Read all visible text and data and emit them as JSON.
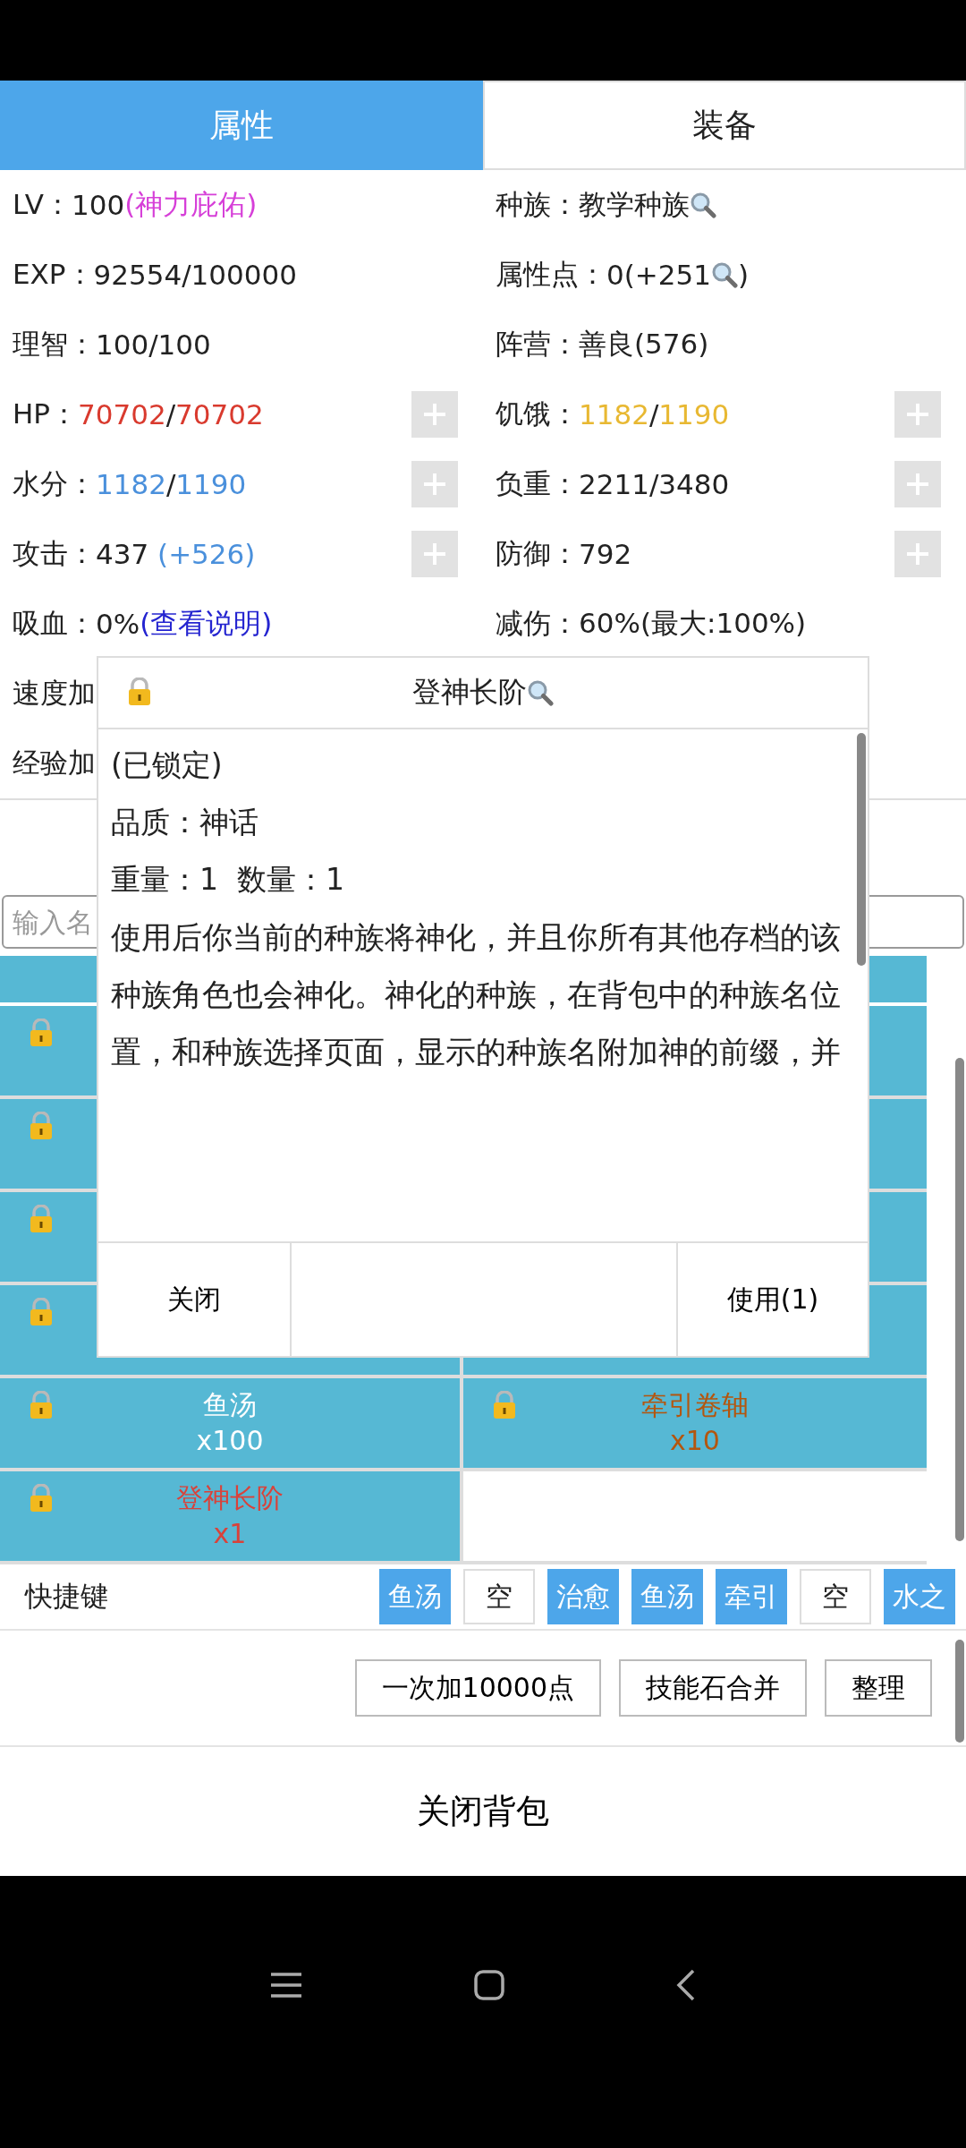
{
  "tabs": [
    {
      "label": "属性",
      "selected": true
    },
    {
      "label": "装备",
      "selected": false
    }
  ],
  "stats": [
    {
      "cells": [
        {
          "label": "LV：",
          "value": [
            {
              "text": "100"
            },
            {
              "text": "(神力庇佑)",
              "color": "#d63fd8"
            }
          ],
          "addable": false
        },
        {
          "label": "种族：",
          "value": [
            {
              "text": "教学种族"
            },
            {
              "kind": "lookup"
            }
          ],
          "addable": false
        }
      ]
    },
    {
      "cells": [
        {
          "label": "EXP：",
          "value": [
            {
              "text": "92554/100000"
            }
          ],
          "addable": false
        },
        {
          "label": "属性点：",
          "value": [
            {
              "text": "0(+251"
            },
            {
              "kind": "lookup"
            },
            {
              "text": ")"
            }
          ],
          "addable": false
        }
      ]
    },
    {
      "cells": [
        {
          "label": "理智：",
          "value": [
            {
              "text": "100/100"
            }
          ],
          "addable": false
        },
        {
          "label": "阵营：",
          "value": [
            {
              "text": "善良(576)"
            }
          ],
          "addable": false
        }
      ]
    },
    {
      "cells": [
        {
          "label": "HP：",
          "value": [
            {
              "text": "70702",
              "color": "#d93a2e"
            },
            {
              "text": "/"
            },
            {
              "text": "70702",
              "color": "#d93a2e"
            }
          ],
          "addable": true
        },
        {
          "label": "饥饿：",
          "value": [
            {
              "text": "1182",
              "color": "#e8b832"
            },
            {
              "text": "/"
            },
            {
              "text": "1190",
              "color": "#e8b832"
            }
          ],
          "addable": true
        }
      ]
    },
    {
      "cells": [
        {
          "label": "水分：",
          "value": [
            {
              "text": "1182",
              "color": "#4a90dc"
            },
            {
              "text": "/"
            },
            {
              "text": "1190",
              "color": "#4a90dc"
            }
          ],
          "addable": true
        },
        {
          "label": "负重：",
          "value": [
            {
              "text": "2211/3480"
            }
          ],
          "addable": true
        }
      ]
    },
    {
      "cells": [
        {
          "label": "攻击：",
          "value": [
            {
              "text": "437 "
            },
            {
              "text": "(+526)",
              "color": "#4a90dc"
            }
          ],
          "addable": true
        },
        {
          "label": "防御：",
          "value": [
            {
              "text": "792"
            }
          ],
          "addable": true
        }
      ]
    },
    {
      "cells": [
        {
          "label": "吸血：",
          "value": [
            {
              "text": "0%"
            },
            {
              "text": "(查看说明)",
              "color": "#2424d0",
              "kind": "link"
            }
          ],
          "addable": false
        },
        {
          "label": "减伤：",
          "value": [
            {
              "text": "60%(最大:100%)"
            }
          ],
          "addable": false
        }
      ]
    },
    {
      "cells": [
        {
          "label": "速度加"
        }
      ]
    },
    {
      "cells": [
        {
          "label": "经验加"
        }
      ]
    }
  ],
  "search": {
    "placeholder": "输入名"
  },
  "items": [
    {
      "kind": "covered",
      "locked": true
    },
    {
      "kind": "covered"
    },
    {
      "kind": "covered",
      "locked": true
    },
    {
      "kind": "covered"
    },
    {
      "kind": "covered",
      "locked": true
    },
    {
      "kind": "covered"
    },
    {
      "kind": "covered",
      "locked": true
    },
    {
      "kind": "covered"
    },
    {
      "kind": "item",
      "locked": true,
      "name": "鱼汤",
      "count": "x100",
      "color": "#ffffff"
    },
    {
      "kind": "item",
      "locked": true,
      "name": "牵引卷轴",
      "count": "x10",
      "color": "#b4560e"
    },
    {
      "kind": "item",
      "locked": true,
      "name": "登神长阶",
      "count": "x1",
      "color": "#d9423a"
    }
  ],
  "quickbar": {
    "label": "快捷键",
    "slots": [
      {
        "label": "鱼汤",
        "filled": true
      },
      {
        "label": "空",
        "filled": false
      },
      {
        "label": "治愈",
        "filled": true
      },
      {
        "label": "鱼汤",
        "filled": true
      },
      {
        "label": "牵引",
        "filled": true
      },
      {
        "label": "空",
        "filled": false
      },
      {
        "label": "水之",
        "filled": true
      }
    ]
  },
  "actions": [
    "一次加10000点",
    "技能石合并",
    "整理"
  ],
  "close_bag": "关闭背包",
  "dialog": {
    "title": "登神长阶",
    "lookup": true,
    "locked": true,
    "lines": [
      "(已锁定)",
      "品质：神话",
      "重量：1  数量：1"
    ],
    "description": "使用后你当前的种族将神化，并且你所有其他存档的该种族角色也会神化。神化的种族，在背包中的种族名位置，和种族选择页面，显示的种族名附加神的前缀，并",
    "buttons": [
      "关闭",
      "使用(1)"
    ]
  }
}
